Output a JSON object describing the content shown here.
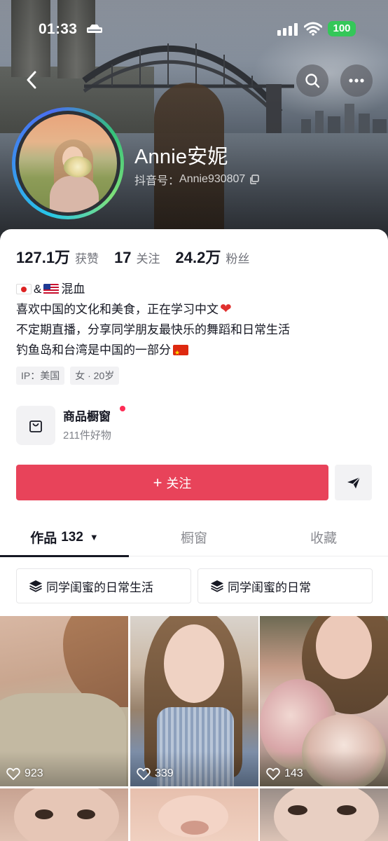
{
  "status_bar": {
    "time": "01:33",
    "battery": "100",
    "battery_color": "#34c759"
  },
  "header": {
    "back_icon": "chevron-left-icon",
    "search_icon": "search-icon",
    "more_icon": "more-horizontal-icon"
  },
  "profile": {
    "name": "Annie安妮",
    "douyin_id_label": "抖音号：",
    "douyin_id": "Annie930807",
    "copy_icon": "copy-icon"
  },
  "stats": [
    {
      "value": "127.1万",
      "label": "获赞"
    },
    {
      "value": "17",
      "label": "关注"
    },
    {
      "value": "24.2万",
      "label": "粉丝"
    }
  ],
  "bio": {
    "line1_suffix": "混血",
    "line1_sep": "&",
    "line2": "喜欢中国的文化和美食，正在学习中文",
    "line3": "不定期直播，分享同学朋友最快乐的舞蹈和日常生活",
    "line4": "钓鱼岛和台湾是中国的一部分"
  },
  "tags": [
    "IP：美国",
    "女 · 20岁"
  ],
  "shop": {
    "title": "商品橱窗",
    "subtitle": "211件好物",
    "icon": "shopping-bag-icon"
  },
  "actions": {
    "follow_plus": "+",
    "follow_label": "关注",
    "follow_color": "#e8435a",
    "message_icon": "send-icon"
  },
  "tabs": {
    "works_label": "作品",
    "works_count": "132",
    "showcase_label": "橱窗",
    "favorites_label": "收藏"
  },
  "collections": [
    {
      "label": "同学闺蜜的日常生活",
      "icon": "layers-icon"
    },
    {
      "label": "同学闺蜜的日常",
      "icon": "layers-icon"
    }
  ],
  "videos": [
    {
      "likes": "923"
    },
    {
      "likes": "339"
    },
    {
      "likes": "143"
    },
    {
      "likes": ""
    },
    {
      "likes": ""
    },
    {
      "likes": ""
    }
  ]
}
